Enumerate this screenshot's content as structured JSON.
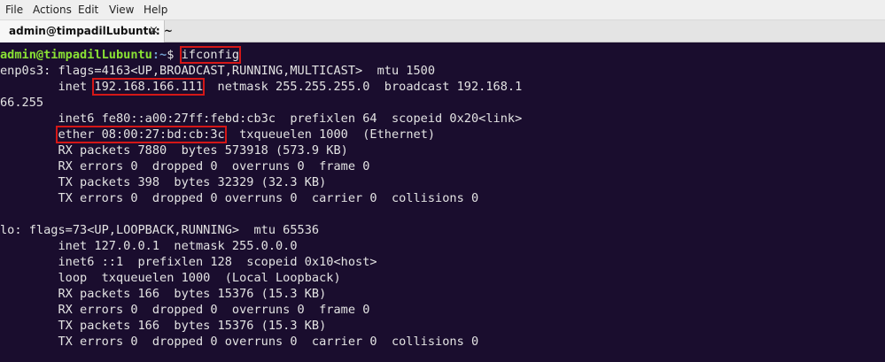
{
  "menu": [
    "File",
    "Actions",
    "Edit",
    "View",
    "Help"
  ],
  "tab": {
    "title": "admin@timpadilLubuntu: ~",
    "close": "×"
  },
  "prompt": {
    "user_host": "admin@timpadilLubuntu",
    "path": ":~",
    "symbol": "$ ",
    "command": "ifconfig"
  },
  "colors": {
    "terminal_bg": "#1a0d2e",
    "prompt_user": "#8ae234",
    "prompt_path": "#729fcf",
    "highlight_box": "#d41717"
  },
  "output": {
    "enp0s3_flags": "enp0s3: flags=4163<UP,BROADCAST,RUNNING,MULTICAST>  mtu 1500",
    "inet_label": "        inet ",
    "inet_ip": "192.168.166.111",
    "inet_rest": "  netmask 255.255.255.0  broadcast 192.168.1",
    "inet_wrap": "66.255",
    "inet6": "        inet6 fe80::a00:27ff:febd:cb3c  prefixlen 64  scopeid 0x20<link>",
    "ether_indent": "        ",
    "ether_mac": "ether 08:00:27:bd:cb:3c",
    "ether_rest": "  txqueuelen 1000  (Ethernet)",
    "rx_packets": "        RX packets 7880  bytes 573918 (573.9 KB)",
    "rx_errors": "        RX errors 0  dropped 0  overruns 0  frame 0",
    "tx_packets": "        TX packets 398  bytes 32329 (32.3 KB)",
    "tx_errors": "        TX errors 0  dropped 0 overruns 0  carrier 0  collisions 0",
    "lo_flags": "lo: flags=73<UP,LOOPBACK,RUNNING>  mtu 65536",
    "lo_inet": "        inet 127.0.0.1  netmask 255.0.0.0",
    "lo_inet6": "        inet6 ::1  prefixlen 128  scopeid 0x10<host>",
    "lo_loop": "        loop  txqueuelen 1000  (Local Loopback)",
    "lo_rx_packets": "        RX packets 166  bytes 15376 (15.3 KB)",
    "lo_rx_errors": "        RX errors 0  dropped 0  overruns 0  frame 0",
    "lo_tx_packets": "        TX packets 166  bytes 15376 (15.3 KB)",
    "lo_tx_errors": "        TX errors 0  dropped 0 overruns 0  carrier 0  collisions 0"
  }
}
